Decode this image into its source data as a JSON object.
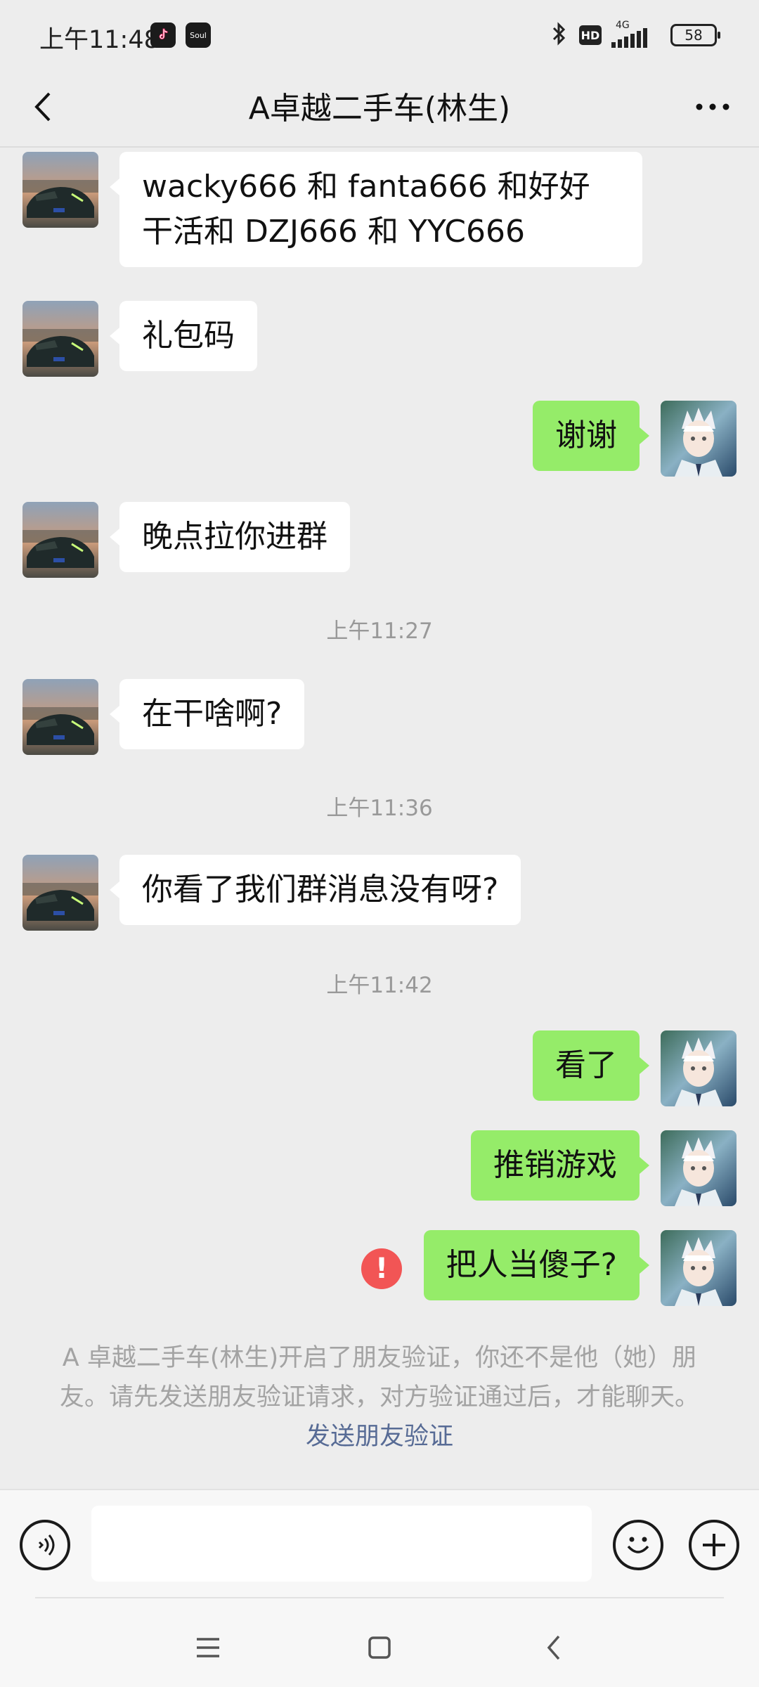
{
  "status_bar": {
    "time": "上午11:48",
    "apps": [
      "tiktok-icon",
      "soul-icon"
    ],
    "soul_label": "Soul",
    "hd_label": "HD",
    "network_label": "4G",
    "battery": "58"
  },
  "header": {
    "title": "A卓越二手车(林生)"
  },
  "messages": {
    "m1": "wacky666 和 fanta666 和好好干活和 DZJ666 和 YYC666",
    "m2": "礼包码",
    "m3": "谢谢",
    "m4": "晚点拉你进群",
    "ts1": "上午11:27",
    "m5": "在干啥啊?",
    "ts2": "上午11:36",
    "m6": "你看了我们群消息没有呀?",
    "ts3": "上午11:42",
    "m7": "看了",
    "m8": "推销游戏",
    "m9": "把人当傻子?",
    "error_mark": "!"
  },
  "notice": {
    "text": "A 卓越二手车(林生)开启了朋友验证，你还不是他（她）朋友。请先发送朋友验证请求，对方验证通过后，才能聊天。",
    "link": "发送朋友验证"
  },
  "input_bar": {
    "voice_icon": "voice-icon",
    "emoji_icon": "emoji-icon",
    "plus_icon": "plus-icon"
  },
  "colors": {
    "outgoing_bubble": "#95ec69",
    "incoming_bubble": "#ffffff",
    "background": "#ededed",
    "link": "#576b95",
    "error": "#f25555"
  }
}
